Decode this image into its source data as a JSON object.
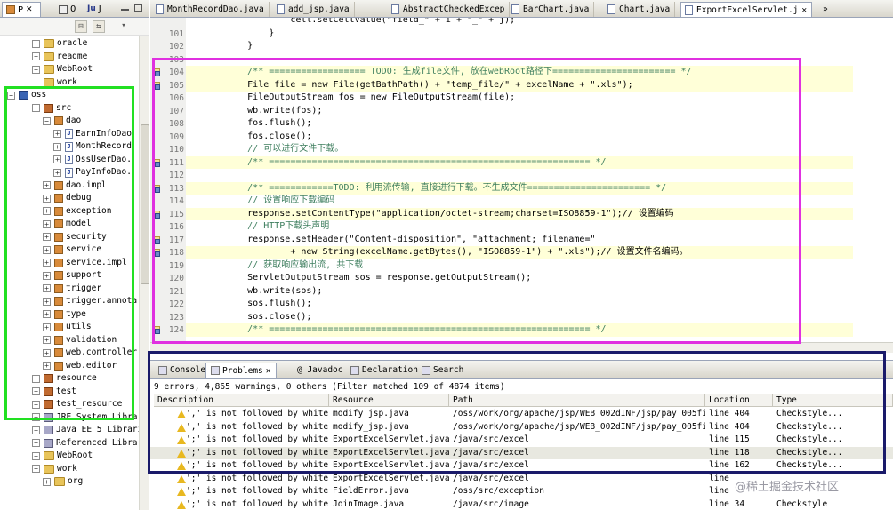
{
  "left_tabs": [
    {
      "label": "P",
      "active": true,
      "close": "✕"
    },
    {
      "label": "0",
      "active": false
    },
    {
      "label": "J",
      "active": false
    }
  ],
  "tree": [
    {
      "indent": 1,
      "exp": "+",
      "icon": "folder",
      "label": "oracle"
    },
    {
      "indent": 1,
      "exp": "+",
      "icon": "folder",
      "label": "readme"
    },
    {
      "indent": 1,
      "exp": "+",
      "icon": "folder",
      "label": "WebRoot"
    },
    {
      "indent": 1,
      "exp": "",
      "icon": "folder",
      "label": "work"
    },
    {
      "indent": 0,
      "exp": "−",
      "icon": "proj",
      "label": "oss"
    },
    {
      "indent": 1,
      "exp": "−",
      "icon": "src",
      "label": "src"
    },
    {
      "indent": 2,
      "exp": "−",
      "icon": "pkg",
      "label": "dao"
    },
    {
      "indent": 3,
      "exp": "+",
      "icon": "jfile",
      "label": "EarnInfoDao"
    },
    {
      "indent": 3,
      "exp": "+",
      "icon": "jfile",
      "label": "MonthRecord"
    },
    {
      "indent": 3,
      "exp": "+",
      "icon": "jfile",
      "label": "OssUserDao."
    },
    {
      "indent": 3,
      "exp": "+",
      "icon": "jfile",
      "label": "PayInfoDao."
    },
    {
      "indent": 2,
      "exp": "+",
      "icon": "pkg",
      "label": "dao.impl"
    },
    {
      "indent": 2,
      "exp": "+",
      "icon": "pkg",
      "label": "debug"
    },
    {
      "indent": 2,
      "exp": "+",
      "icon": "pkg",
      "label": "exception"
    },
    {
      "indent": 2,
      "exp": "+",
      "icon": "pkg",
      "label": "model"
    },
    {
      "indent": 2,
      "exp": "+",
      "icon": "pkg",
      "label": "security"
    },
    {
      "indent": 2,
      "exp": "+",
      "icon": "pkg",
      "label": "service"
    },
    {
      "indent": 2,
      "exp": "+",
      "icon": "pkg",
      "label": "service.impl"
    },
    {
      "indent": 2,
      "exp": "+",
      "icon": "pkg",
      "label": "support"
    },
    {
      "indent": 2,
      "exp": "+",
      "icon": "pkg",
      "label": "trigger"
    },
    {
      "indent": 2,
      "exp": "+",
      "icon": "pkg",
      "label": "trigger.annota"
    },
    {
      "indent": 2,
      "exp": "+",
      "icon": "pkg",
      "label": "type"
    },
    {
      "indent": 2,
      "exp": "+",
      "icon": "pkg",
      "label": "utils"
    },
    {
      "indent": 2,
      "exp": "+",
      "icon": "pkg",
      "label": "validation"
    },
    {
      "indent": 2,
      "exp": "+",
      "icon": "pkg",
      "label": "web.controller"
    },
    {
      "indent": 2,
      "exp": "+",
      "icon": "pkg",
      "label": "web.editor"
    },
    {
      "indent": 1,
      "exp": "+",
      "icon": "src",
      "label": "resource"
    },
    {
      "indent": 1,
      "exp": "+",
      "icon": "src",
      "label": "test"
    },
    {
      "indent": 1,
      "exp": "+",
      "icon": "src",
      "label": "test_resource"
    },
    {
      "indent": 1,
      "exp": "+",
      "icon": "lib",
      "label": "JRE System Library"
    },
    {
      "indent": 1,
      "exp": "+",
      "icon": "lib",
      "label": "Java EE 5 Libraries"
    },
    {
      "indent": 1,
      "exp": "+",
      "icon": "lib",
      "label": "Referenced Libraries"
    },
    {
      "indent": 1,
      "exp": "+",
      "icon": "folder",
      "label": "WebRoot"
    },
    {
      "indent": 1,
      "exp": "−",
      "icon": "folder",
      "label": "work"
    },
    {
      "indent": 2,
      "exp": "+",
      "icon": "folder",
      "label": "org"
    }
  ],
  "editor_tabs": [
    {
      "label": "MonthRecordDao.java",
      "active": false
    },
    {
      "label": "add_jsp.java",
      "active": false
    },
    {
      "label": "AbstractCheckedExcep",
      "active": false
    },
    {
      "label": "BarChart.java",
      "active": false
    },
    {
      "label": "Chart.java",
      "active": false
    },
    {
      "label": "ExportExcelServlet.j",
      "active": true,
      "close": "✕"
    }
  ],
  "editor_overflow": "»",
  "code": [
    {
      "n": "",
      "text": "                cell.setCellValue(\"field_\" + i + \"_\" + j);",
      "marker": false,
      "hl": false
    },
    {
      "n": "101",
      "text": "            }",
      "marker": false,
      "hl": false
    },
    {
      "n": "102",
      "text": "        }",
      "marker": false,
      "hl": false
    },
    {
      "n": "103",
      "text": "",
      "marker": false,
      "hl": false
    },
    {
      "n": "104",
      "text": "        /** ================== TODO: 生成file文件, 放在webRoot路径下======================= */",
      "marker": true,
      "hl": true,
      "type": "cmt"
    },
    {
      "n": "105",
      "text": "        File file = new File(getBathPath() + \"temp_file/\" + excelName + \".xls\");",
      "marker": true,
      "hl": true,
      "type": "code"
    },
    {
      "n": "106",
      "text": "        FileOutputStream fos = new FileOutputStream(file);",
      "marker": false,
      "hl": false,
      "type": "code"
    },
    {
      "n": "107",
      "text": "        wb.write(fos);",
      "marker": false,
      "hl": false,
      "type": "code"
    },
    {
      "n": "108",
      "text": "        fos.flush();",
      "marker": false,
      "hl": false,
      "type": "code"
    },
    {
      "n": "109",
      "text": "        fos.close();",
      "marker": false,
      "hl": false,
      "type": "code"
    },
    {
      "n": "110",
      "text": "        // 可以进行文件下载。",
      "marker": false,
      "hl": false,
      "type": "cmt"
    },
    {
      "n": "111",
      "text": "        /** ============================================================ */",
      "marker": true,
      "hl": true,
      "type": "cmt"
    },
    {
      "n": "112",
      "text": "",
      "marker": false,
      "hl": false
    },
    {
      "n": "113",
      "text": "        /** ============TODO: 利用流传输, 直接进行下载。不生成文件======================= */",
      "marker": true,
      "hl": true,
      "type": "cmt"
    },
    {
      "n": "114",
      "text": "        // 设置响应下载编码",
      "marker": false,
      "hl": false,
      "type": "cmt"
    },
    {
      "n": "115",
      "text": "        response.setContentType(\"application/octet-stream;charset=ISO8859-1\");// 设置编码",
      "marker": true,
      "hl": true,
      "type": "code"
    },
    {
      "n": "116",
      "text": "        // HTTP下载头声明",
      "marker": false,
      "hl": false,
      "type": "cmt"
    },
    {
      "n": "117",
      "text": "        response.setHeader(\"Content-disposition\", \"attachment; filename=\"",
      "marker": true,
      "hl": false,
      "type": "code"
    },
    {
      "n": "118",
      "text": "                + new String(excelName.getBytes(), \"ISO8859-1\") + \".xls\");// 设置文件名编码。",
      "marker": true,
      "hl": true,
      "type": "code"
    },
    {
      "n": "119",
      "text": "        // 获取响应输出流, 共下载",
      "marker": false,
      "hl": false,
      "type": "cmt"
    },
    {
      "n": "120",
      "text": "        ServletOutputStream sos = response.getOutputStream();",
      "marker": false,
      "hl": false,
      "type": "code"
    },
    {
      "n": "121",
      "text": "        wb.write(sos);",
      "marker": false,
      "hl": false,
      "type": "code"
    },
    {
      "n": "122",
      "text": "        sos.flush();",
      "marker": false,
      "hl": false,
      "type": "code"
    },
    {
      "n": "123",
      "text": "        sos.close();",
      "marker": false,
      "hl": false,
      "type": "code"
    },
    {
      "n": "124",
      "text": "        /** ============================================================ */",
      "marker": true,
      "hl": true,
      "type": "cmt"
    }
  ],
  "bottom_tabs": [
    {
      "label": "Console",
      "active": false
    },
    {
      "label": "Problems",
      "active": true,
      "close": "✕"
    },
    {
      "label": "@ Javadoc",
      "active": false
    },
    {
      "label": "Declaration",
      "active": false
    },
    {
      "label": "Search",
      "active": false
    }
  ],
  "problems": {
    "summary": "9 errors, 4,865 warnings, 0 others (Filter matched 109 of 4874 items)",
    "headers": [
      "Description",
      "Resource",
      "Path",
      "Location",
      "Type"
    ],
    "rows": [
      {
        "desc": "',' is not followed by white",
        "res": "modify_jsp.java",
        "path": "/oss/work/org/apache/jsp/WEB_002dINF/jsp/pay_005finfo",
        "loc": "line 404",
        "type": "Checkstyle...",
        "sel": false
      },
      {
        "desc": "',' is not followed by white",
        "res": "modify_jsp.java",
        "path": "/oss/work/org/apache/jsp/WEB_002dINF/jsp/pay_005finfo",
        "loc": "line 404",
        "type": "Checkstyle...",
        "sel": false
      },
      {
        "desc": "';' is not followed by white",
        "res": "ExportExcelServlet.java",
        "path": "/java/src/excel",
        "loc": "line 115",
        "type": "Checkstyle...",
        "sel": false
      },
      {
        "desc": "';' is not followed by white",
        "res": "ExportExcelServlet.java",
        "path": "/java/src/excel",
        "loc": "line 118",
        "type": "Checkstyle...",
        "sel": true
      },
      {
        "desc": "';' is not followed by white",
        "res": "ExportExcelServlet.java",
        "path": "/java/src/excel",
        "loc": "line 162",
        "type": "Checkstyle...",
        "sel": false
      },
      {
        "desc": "';' is not followed by white",
        "res": "ExportExcelServlet.java",
        "path": "/java/src/excel",
        "loc": "line",
        "type": "",
        "sel": false
      },
      {
        "desc": "';' is not followed by white",
        "res": "FieldError.java",
        "path": "/oss/src/exception",
        "loc": "line",
        "type": "",
        "sel": false
      },
      {
        "desc": "';' is not followed by white",
        "res": "JoinImage.java",
        "path": "/java/src/image",
        "loc": "line 34",
        "type": "Checkstyle",
        "sel": false
      }
    ]
  },
  "watermark": "@稀土掘金技术社区",
  "colors": {
    "green_box": "#22e022",
    "magenta_box": "#e030e0",
    "navy_box": "#1a1a6a"
  }
}
